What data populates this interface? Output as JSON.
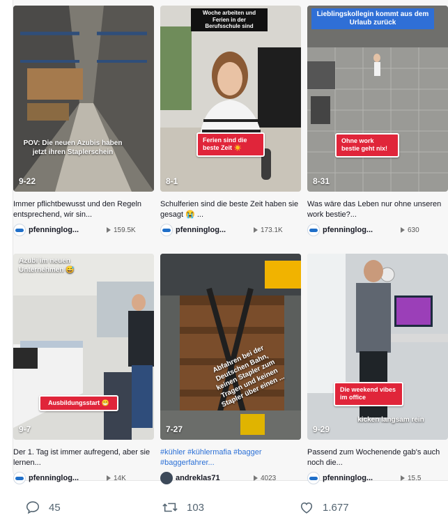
{
  "grid": {
    "tiles": [
      {
        "date": "9-22",
        "overlay": "POV: Die neuen Azubis haben jetzt ihren Staplerschein",
        "caption": "Immer pflichtbewusst und den Regeln entsprechend, wir sin...",
        "username": "pfenninglog...",
        "plays": "159.5K"
      },
      {
        "date": "8-1",
        "top_caption": "Woche arbeiten und Ferien in der Berufsschule sind",
        "sticker": "Ferien sind die beste Zeit ☀️",
        "caption": "Schulferien sind die beste Zeit haben sie gesagt 😭 ...",
        "username": "pfenninglog...",
        "plays": "173.1K"
      },
      {
        "date": "8-31",
        "top_caption": "Lieblingskollegin kommt aus dem Urlaub zurück",
        "sticker": "Ohne work bestie geht nix!",
        "caption": "Was wäre das Leben nur ohne unseren work bestie?...",
        "username": "pfenninglog...",
        "plays": "630"
      },
      {
        "date": "9-7",
        "top_caption": "Azubi im neuen Unternehmen 😅",
        "sticker": "Ausbildungsstart 😁",
        "caption": "Der 1. Tag ist immer aufregend, aber sie lernen...",
        "username": "pfenninglog...",
        "plays": "14K"
      },
      {
        "date": "7-27",
        "overlay": "Abfahren bei der Deutschen Bahn, keinen Stapler zum Tragen und keinen Stapler über einen ...",
        "caption": "#kühler #kühlermafia #bagger #baggerfahrer...",
        "username": "andreklas71",
        "plays": "4023"
      },
      {
        "date": "9-29",
        "overlay": "kicken langsam rein",
        "sticker": "Die weekend vibes im office",
        "caption": "Passend zum Wochenende gab's auch noch die...",
        "username": "pfenninglog...",
        "plays": "15.5"
      }
    ]
  },
  "actions": {
    "replies": "45",
    "reposts": "103",
    "likes": "1.677"
  },
  "colors": {
    "sticker_red": "#e0253a",
    "hashtag_blue": "#2a6fd6",
    "icon_gray": "#536471"
  }
}
